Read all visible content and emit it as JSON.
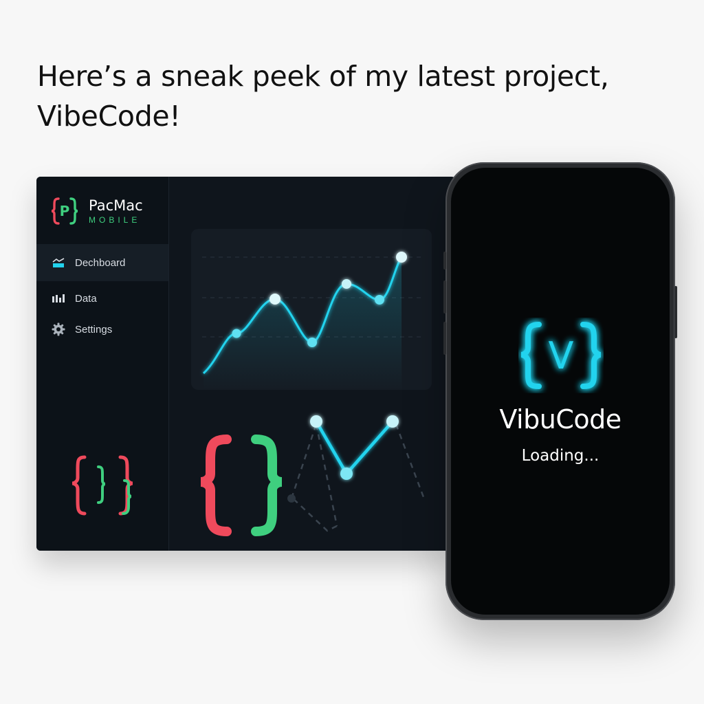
{
  "headline": "Here’s a sneak peek of my latest project, VibeCode!",
  "desktop": {
    "brand": {
      "name": "PacMac",
      "subtitle": "MOBILE",
      "logo_letter": "P"
    },
    "nav": [
      {
        "label": "Dechboard",
        "icon": "dashboard-icon",
        "active": true
      },
      {
        "label": "Data",
        "icon": "bar-chart-icon",
        "active": false
      },
      {
        "label": "Settings",
        "icon": "gear-icon",
        "active": false
      }
    ]
  },
  "phone": {
    "app_name": "VibuCode",
    "status": "Loading...",
    "logo_letter": "V"
  },
  "colors": {
    "accent_cyan": "#22d3ee",
    "brace_red": "#ef4a5c",
    "brace_green": "#3fcf7f",
    "panel_bg": "#0f151c"
  }
}
